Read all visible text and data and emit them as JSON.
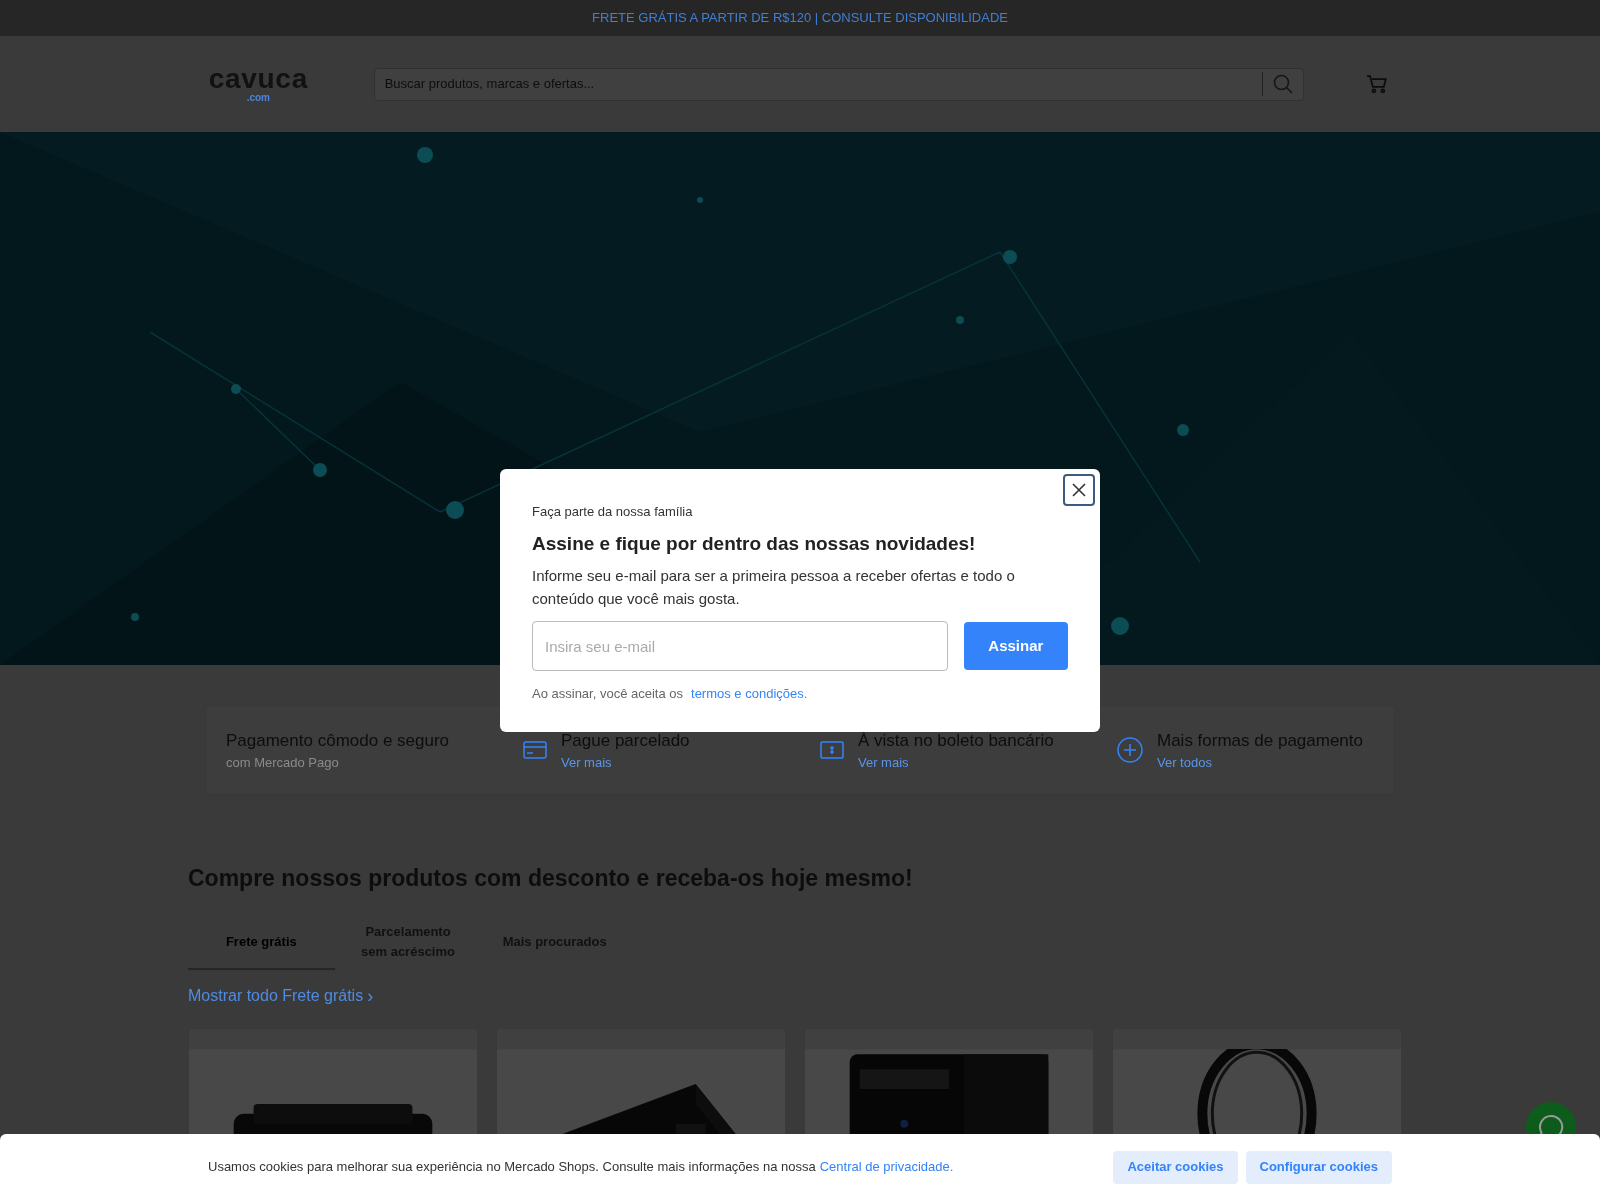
{
  "announcement": "FRETE GRÁTIS A PARTIR DE R$120 | CONSULTE DISPONIBILIDADE",
  "header": {
    "logo": "cavuca",
    "logo_suffix": ".com",
    "search": {
      "placeholder": "Buscar produtos, marcas e ofertas..."
    }
  },
  "benefits": [
    {
      "kind": "text",
      "title": "Pagamento cômodo e seguro",
      "subtitle": "com Mercado Pago"
    },
    {
      "kind": "card",
      "title": "Pague parcelado",
      "link": "Ver mais"
    },
    {
      "kind": "cash",
      "title": "À vista no boleto bancário",
      "link": "Ver mais"
    },
    {
      "kind": "plus",
      "title": "Mais formas de pagamento",
      "link": "Ver todos"
    }
  ],
  "section": {
    "title": "Compre nossos produtos com desconto e receba-os hoje mesmo!",
    "tabs": [
      {
        "label": "Frete grátis",
        "selected": true
      },
      {
        "label": "Parcelamento sem acréscimo",
        "selected": false
      },
      {
        "label": "Mais procurados",
        "selected": false
      }
    ],
    "show_all": "Mostrar todo Frete grátis",
    "show_all_arrow": "›",
    "products": [
      {
        "kind": "printer"
      },
      {
        "kind": "box"
      },
      {
        "kind": "ups"
      },
      {
        "kind": "cable"
      }
    ]
  },
  "modal": {
    "eyebrow": "Faça parte da nossa família",
    "title": "Assine e fique por dentro das nossas novidades!",
    "text": "Informe seu e-mail para ser a primeira pessoa a receber ofertas e todo o conteúdo que você mais gosta.",
    "email": {
      "placeholder": "Insira seu e-mail"
    },
    "submit": "Assinar",
    "terms_prefix": "Ao assinar, você aceita os",
    "terms_link": "termos e condições."
  },
  "cookies": {
    "text": "Usamos cookies para melhorar sua experiência no Mercado Shops. Consulte mais informações na nossa",
    "link": "Central de privacidade.",
    "buttons": [
      "Aceitar cookies",
      "Configurar cookies"
    ]
  }
}
